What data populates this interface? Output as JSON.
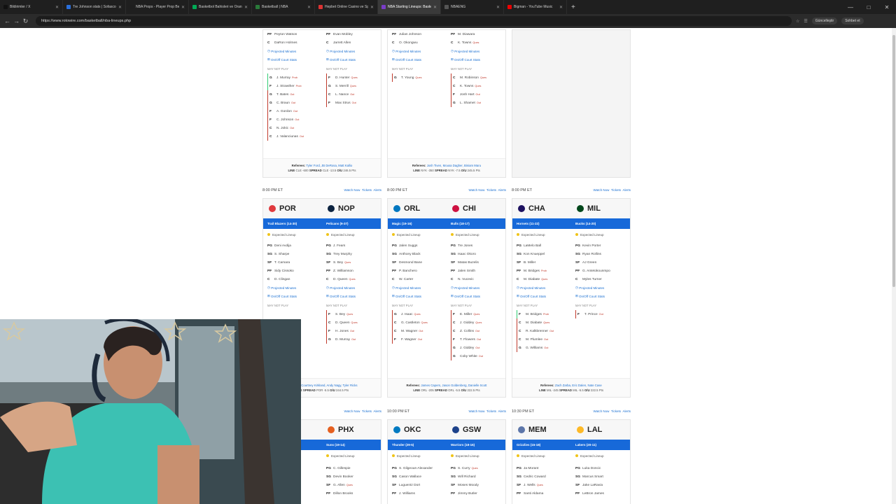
{
  "tabs": [
    {
      "title": "Bildirimler / X",
      "fav": "#111"
    },
    {
      "title": "Tre Johnson stats | Sofascore",
      "fav": "#2a6fdb"
    },
    {
      "title": "NBA Props - Player Prop Betting &...",
      "fav": "#1e1e1e"
    },
    {
      "title": "Basketbol Bahisleri ve Oranları - S...",
      "fav": "#0a5"
    },
    {
      "title": "Basketball | NBA",
      "fav": "#2a7a3a"
    },
    {
      "title": "Hepbet Online Casino ve Spor Bah...",
      "fav": "#d33"
    },
    {
      "title": "NBA Starting Lineups: Basketball |...",
      "fav": "#7a3cc8",
      "active": true
    },
    {
      "title": "NBAENG",
      "fav": "#555"
    },
    {
      "title": "Bigman - YouTube Music",
      "fav": "#e00"
    }
  ],
  "url": "https://www.rotowire.com/basketball/nba-lineups.php",
  "update_label": "Güncelleştir",
  "profile_label": "Sohbet et",
  "top": {
    "c1": {
      "home": [
        [
          "PF",
          "Peyton Watson",
          ""
        ],
        [
          "C",
          "DaRon Holmes",
          ""
        ]
      ],
      "away": [
        [
          "PF",
          "Evan Mobley",
          ""
        ],
        [
          "C",
          "Jarrett Allen",
          ""
        ]
      ],
      "mnp_home": [
        [
          "G",
          "J. Murray",
          "Prob"
        ],
        [
          "F",
          "J. Strawther",
          "Prob"
        ],
        [
          "G",
          "T. Bates",
          "Out"
        ],
        [
          "G",
          "C. Braun",
          "Out"
        ],
        [
          "F",
          "A. Gordon",
          "Out"
        ],
        [
          "F",
          "C. Johnson",
          "Out"
        ],
        [
          "C",
          "N. Jokic",
          "Out"
        ],
        [
          "C",
          "J. Valanciunas",
          "Out"
        ]
      ],
      "mnp_away": [
        [
          "F",
          "D. Hunter",
          "Ques"
        ],
        [
          "G",
          "S. Merrill",
          "Ques"
        ],
        [
          "C",
          "L. Nance",
          "Out"
        ],
        [
          "F",
          "Max Strus",
          "Out"
        ]
      ],
      "refs": "Tyler Ford, JB DeRosa, Matt Kallio",
      "line": "CLE -600",
      "spread": "CLE -13.5",
      "ou": "246.5 Pts"
    },
    "c2": {
      "home": [
        [
          "PF",
          "Julian Johnson",
          ""
        ],
        [
          "C",
          "O. Okongwu",
          ""
        ]
      ],
      "away": [
        [
          "PF",
          "M. Diawara",
          ""
        ],
        [
          "C",
          "K. Towns",
          "Ques"
        ]
      ],
      "mnp_home": [
        [
          "G",
          "T. Young",
          "Ques"
        ]
      ],
      "mnp_away": [
        [
          "C",
          "M. Robinson",
          "Ques"
        ],
        [
          "C",
          "K. Towns",
          "Ques"
        ],
        [
          "F",
          "Josh Hart",
          "Out"
        ],
        [
          "G",
          "L. Shamet",
          "Out"
        ]
      ],
      "refs": "Josh Tiven, Mousa Dagher, Biniam Maru",
      "line": "NYK -350",
      "spread": "NYK -7.5",
      "ou": "245.5 Pts"
    }
  },
  "labels": {
    "proj": "Projected Minutes",
    "onoff": "On/Off Court Stats",
    "mnp": "MAY NOT PLAY",
    "exp": "Expected Lineup",
    "watch": "Watch Now",
    "tickets": "Tickets",
    "alerts": "Alerts",
    "refs": "Referees:",
    "line": "LINE",
    "spread": "SPREAD",
    "ou": "O/U"
  },
  "games": [
    {
      "time": "8:00 PM ET",
      "home": {
        "abbr": "POR",
        "name": "Trail Blazers",
        "rec": "(14-30)",
        "color": "#e03a3e"
      },
      "away": {
        "abbr": "NOP",
        "name": "Pelicans",
        "rec": "(9-37)",
        "color": "#0c2340"
      },
      "hl": [
        [
          "PG",
          "Deni Avdija",
          ""
        ],
        [
          "SG",
          "S. Sharpe",
          ""
        ],
        [
          "SF",
          "T. Camara",
          ""
        ],
        [
          "PF",
          "Sidy Cissoko",
          ""
        ],
        [
          "C",
          "D. Clingan",
          ""
        ]
      ],
      "al": [
        [
          "PG",
          "J. Fears",
          ""
        ],
        [
          "SG",
          "Trey Murphy",
          ""
        ],
        [
          "SF",
          "S. Bey",
          "Ques"
        ],
        [
          "PF",
          "Z. Williamson",
          ""
        ],
        [
          "C",
          "D. Queen",
          "Ques"
        ]
      ],
      "mh": [],
      "ma": [
        [
          "F",
          "S. Bey",
          "Ques"
        ],
        [
          "C",
          "D. Queen",
          "Ques"
        ],
        [
          "F",
          "H. Jones",
          "Out"
        ],
        [
          "G",
          "D. Murray",
          "Out"
        ]
      ],
      "refs": "Courtney Kirkland, Andy Nagy, Tyler Ricks",
      "line": "",
      "spread": "POR -5.5",
      "ou": "244.5 Pts"
    },
    {
      "time": "8:00 PM ET",
      "home": {
        "abbr": "ORL",
        "name": "Magic",
        "rec": "(19-16)",
        "color": "#0077c0"
      },
      "away": {
        "abbr": "CHI",
        "name": "Bulls",
        "rec": "(18-17)",
        "color": "#ce1141"
      },
      "hl": [
        [
          "PG",
          "Jalen Suggs",
          ""
        ],
        [
          "SG",
          "Anthony Black",
          ""
        ],
        [
          "SF",
          "Desmond Bane",
          ""
        ],
        [
          "PF",
          "P. Banchero",
          ""
        ],
        [
          "C",
          "W. Carter",
          ""
        ]
      ],
      "al": [
        [
          "PG",
          "Tre Jones",
          ""
        ],
        [
          "SG",
          "Isaac Okoro",
          ""
        ],
        [
          "SF",
          "Matas Buzelis",
          ""
        ],
        [
          "PF",
          "Jalen Smith",
          ""
        ],
        [
          "C",
          "N. Vucevic",
          ""
        ]
      ],
      "mh": [
        [
          "G",
          "J. Isaac",
          "Ques"
        ],
        [
          "C",
          "G. Castleton",
          "Ques"
        ],
        [
          "C",
          "M. Wagner",
          "Out"
        ],
        [
          "F",
          "F. Wagner",
          "Out"
        ]
      ],
      "ma": [
        [
          "F",
          "E. Miller",
          "Ques"
        ],
        [
          "C",
          "J. Giddey",
          "Ques"
        ],
        [
          "C",
          "Z. Collins",
          "Out"
        ],
        [
          "F",
          "T. Flowers",
          "Out"
        ],
        [
          "G",
          "J. Giddey",
          "Out"
        ],
        [
          "G",
          "Coby White",
          "Out"
        ]
      ],
      "refs": "James Capers, Jason Goldenberg, Danielle Scott",
      "line": "ORL -205",
      "spread": "ORL -5.5",
      "ou": "222.5 Pts"
    },
    {
      "time": "8:00 PM ET",
      "home": {
        "abbr": "CHA",
        "name": "Hornets",
        "rec": "(11-22)",
        "color": "#1d1160"
      },
      "away": {
        "abbr": "MIL",
        "name": "Bucks",
        "rec": "(14-20)",
        "color": "#00471b"
      },
      "hl": [
        [
          "PG",
          "LaMelo Ball",
          ""
        ],
        [
          "SG",
          "Kon Knueppel",
          ""
        ],
        [
          "SF",
          "B. Miller",
          ""
        ],
        [
          "PF",
          "M. Bridges",
          "Prob"
        ],
        [
          "C",
          "M. Diabate",
          "Ques"
        ]
      ],
      "al": [
        [
          "PG",
          "Kevin Porter",
          ""
        ],
        [
          "SG",
          "Ryan Rollins",
          ""
        ],
        [
          "SF",
          "AJ Green",
          ""
        ],
        [
          "PF",
          "G. Antetokounmpo",
          ""
        ],
        [
          "C",
          "Myles Turner",
          ""
        ]
      ],
      "mh": [
        [
          "F",
          "M. Bridges",
          "Prob"
        ],
        [
          "C",
          "M. Diabate",
          "Ques"
        ],
        [
          "C",
          "R. Kalkbrenner",
          "Out"
        ],
        [
          "C",
          "M. Plumlee",
          "Out"
        ],
        [
          "G",
          "G. Williams",
          "Out"
        ]
      ],
      "ma": [
        [
          "F",
          "T. Prince",
          "Out"
        ]
      ],
      "refs": "Zach Zarba, Eric Dalen, Nate Case",
      "line": "MIL -245",
      "spread": "MIL -5.5",
      "ou": "222.5 Pts"
    }
  ],
  "games2": [
    {
      "time": "",
      "home": {
        "abbr": "",
        "name": "",
        "rec": "",
        "color": "#fff"
      },
      "away": {
        "abbr": "PHX",
        "name": "Suns",
        "rec": "(19-14)",
        "color": "#e56020"
      },
      "hl": [],
      "al": [
        [
          "PG",
          "C. Gillespie",
          ""
        ],
        [
          "SG",
          "Devin Booker",
          ""
        ],
        [
          "SF",
          "G. Allen",
          "Ques"
        ],
        [
          "PF",
          "Dillon Brooks",
          ""
        ]
      ]
    },
    {
      "time": "10:00 PM ET",
      "home": {
        "abbr": "OKC",
        "name": "Thunder",
        "rec": "(29-5)",
        "color": "#007ac1"
      },
      "away": {
        "abbr": "GSW",
        "name": "Warriors",
        "rec": "(18-16)",
        "color": "#1d428a"
      },
      "hl": [
        [
          "PG",
          "S. Gilgeous-Alexander",
          ""
        ],
        [
          "SG",
          "Cason Wallace",
          ""
        ],
        [
          "SF",
          "Luguentz Dort",
          ""
        ],
        [
          "PF",
          "J. Williams",
          ""
        ]
      ],
      "al": [
        [
          "PG",
          "S. Curry",
          "Ques"
        ],
        [
          "SG",
          "Will Richard",
          ""
        ],
        [
          "SF",
          "Moses Moody",
          ""
        ],
        [
          "PF",
          "Jimmy Butler",
          ""
        ]
      ]
    },
    {
      "time": "10:30 PM ET",
      "home": {
        "abbr": "MEM",
        "name": "Grizzlies",
        "rec": "(15-18)",
        "color": "#5d76a9"
      },
      "away": {
        "abbr": "LAL",
        "name": "Lakers",
        "rec": "(20-11)",
        "color": "#fdb927"
      },
      "hl": [
        [
          "PG",
          "Ja Morant",
          ""
        ],
        [
          "SG",
          "Cedric Coward",
          ""
        ],
        [
          "SF",
          "J. Wells",
          "Ques"
        ],
        [
          "PF",
          "Santi Aldama",
          ""
        ]
      ],
      "al": [
        [
          "PG",
          "Luka Doncic",
          ""
        ],
        [
          "SG",
          "Marcus Smart",
          ""
        ],
        [
          "SF",
          "Jake LaRavia",
          ""
        ],
        [
          "PF",
          "LeBron James",
          ""
        ]
      ]
    }
  ]
}
